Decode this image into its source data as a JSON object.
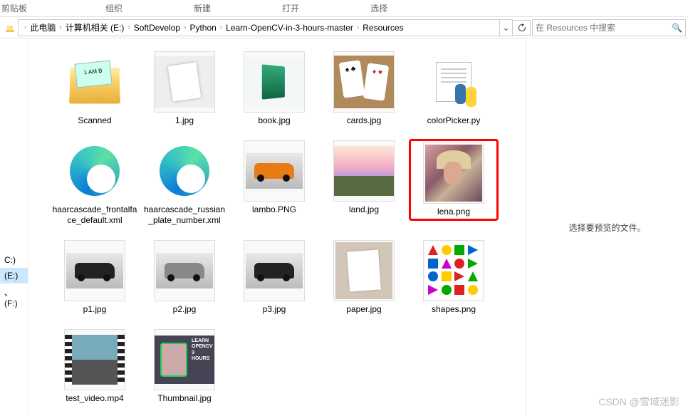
{
  "ribbon": {
    "tabs": [
      "剪贴板",
      "组织",
      "新建",
      "打开",
      "选择"
    ]
  },
  "breadcrumb": [
    "此电脑",
    "计算机相关 (E:)",
    "SoftDevelop",
    "Python",
    "Learn-OpenCV-in-3-hours-master",
    "Resources"
  ],
  "search": {
    "placeholder": "在 Resources 中搜索"
  },
  "sidebar": {
    "drives": [
      "C:)",
      "(E:)",
      "、 (F:)"
    ],
    "active_index": 1
  },
  "preview": {
    "empty_text": "选择要预览的文件。"
  },
  "items": [
    {
      "name": "Scanned",
      "type": "folder"
    },
    {
      "name": "1.jpg",
      "type": "image"
    },
    {
      "name": "book.jpg",
      "type": "image"
    },
    {
      "name": "cards.jpg",
      "type": "image"
    },
    {
      "name": "colorPicker.py",
      "type": "python"
    },
    {
      "name": "haarcascade_frontalface_default.xml",
      "type": "xml"
    },
    {
      "name": "haarcascade_russian_plate_number.xml",
      "type": "xml"
    },
    {
      "name": "lambo.PNG",
      "type": "image"
    },
    {
      "name": "land.jpg",
      "type": "image"
    },
    {
      "name": "lena.png",
      "type": "image",
      "highlighted": true
    },
    {
      "name": "p1.jpg",
      "type": "image"
    },
    {
      "name": "p2.jpg",
      "type": "image"
    },
    {
      "name": "p3.jpg",
      "type": "image"
    },
    {
      "name": "paper.jpg",
      "type": "image"
    },
    {
      "name": "shapes.png",
      "type": "image"
    },
    {
      "name": "test_video.mp4",
      "type": "video"
    },
    {
      "name": "Thumbnail.jpg",
      "type": "image"
    }
  ],
  "watermark": "CSDN @雪域迷影"
}
